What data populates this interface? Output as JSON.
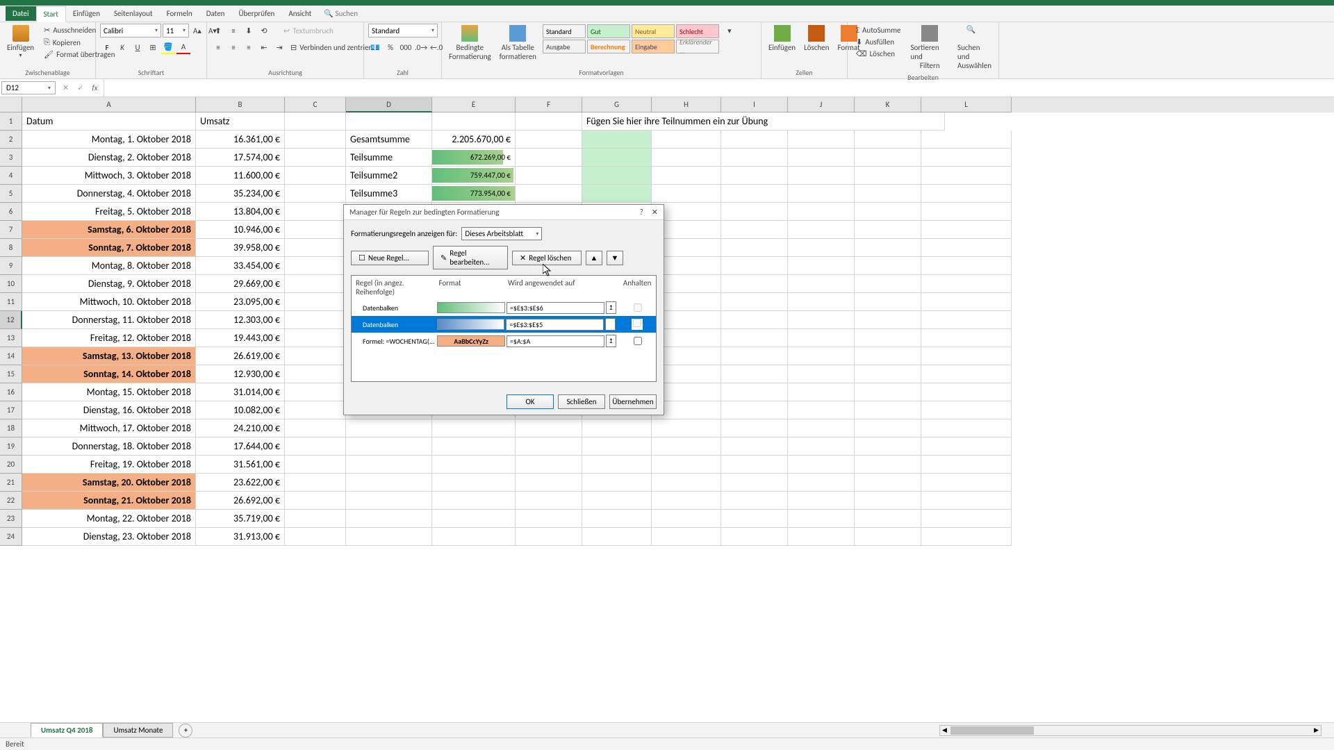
{
  "menu": {
    "datei": "Datei",
    "start": "Start",
    "einfugen": "Einfügen",
    "seitenlayout": "Seitenlayout",
    "formeln": "Formeln",
    "daten": "Daten",
    "uberprufen": "Überprüfen",
    "ansicht": "Ansicht",
    "suchen": "Suchen"
  },
  "ribbon": {
    "clipboard": {
      "paste": "Einfügen",
      "cut": "Ausschneiden",
      "copy": "Kopieren",
      "fmt": "Format übertragen",
      "label": "Zwischenablage"
    },
    "font": {
      "name": "Calibri",
      "size": "11",
      "label": "Schriftart"
    },
    "align": {
      "wrap": "Textumbruch",
      "merge": "Verbinden und zentrieren",
      "label": "Ausrichtung"
    },
    "number": {
      "format": "Standard",
      "label": "Zahl"
    },
    "styles": {
      "cond": "Bedingte",
      "cond2": "Formatierung",
      "table": "Als Tabelle",
      "table2": "formatieren",
      "std": "Standard",
      "gut": "Gut",
      "neutral": "Neutral",
      "schlecht": "Schlecht",
      "ausgabe": "Ausgabe",
      "berechnung": "Berechnung",
      "eingabe": "Eingabe",
      "erkl": "Erklärender ...",
      "label": "Formatvorlagen"
    },
    "cells": {
      "insert": "Einfügen",
      "delete": "Löschen",
      "format": "Format",
      "label": "Zellen"
    },
    "edit": {
      "sum": "AutoSumme",
      "fill": "Ausfüllen",
      "clear": "Löschen",
      "sort": "Sortieren und",
      "sort2": "Filtern",
      "find": "Suchen und",
      "find2": "Auswählen",
      "label": "Bearbeiten"
    }
  },
  "namebox": "D12",
  "columns": [
    "A",
    "B",
    "C",
    "D",
    "E",
    "F",
    "G",
    "H",
    "I",
    "J",
    "K",
    "L"
  ],
  "headers": {
    "datum": "Datum",
    "umsatz": "Umsatz",
    "note": "Fügen Sie hier ihre Teilnummen ein zur Übung"
  },
  "rows": [
    {
      "n": 2,
      "a": "Montag, 1. Oktober 2018",
      "b": "16.361,00 €",
      "d": "Gesamtsumme",
      "e": "2.205.670,00 €"
    },
    {
      "n": 3,
      "a": "Dienstag, 2. Oktober 2018",
      "b": "17.574,00 €",
      "d": "Teilsumme",
      "e": "672.269,00 €"
    },
    {
      "n": 4,
      "a": "Mittwoch, 3. Oktober 2018",
      "b": "11.600,00 €",
      "d": "Teilsumme2",
      "e": "759.447,00 €"
    },
    {
      "n": 5,
      "a": "Donnerstag, 4. Oktober 2018",
      "b": "35.234,00 €",
      "d": "Teilsumme3",
      "e": "773.954,00 €"
    },
    {
      "n": 6,
      "a": "Freitag, 5. Oktober 2018",
      "b": "13.804,00 €"
    },
    {
      "n": 7,
      "a": "Samstag, 6. Oktober 2018",
      "b": "10.946,00 €",
      "wk": true
    },
    {
      "n": 8,
      "a": "Sonntag, 7. Oktober 2018",
      "b": "39.958,00 €",
      "wk": true
    },
    {
      "n": 9,
      "a": "Montag, 8. Oktober 2018",
      "b": "33.454,00 €"
    },
    {
      "n": 10,
      "a": "Dienstag, 9. Oktober 2018",
      "b": "29.669,00 €"
    },
    {
      "n": 11,
      "a": "Mittwoch, 10. Oktober 2018",
      "b": "23.095,00 €"
    },
    {
      "n": 12,
      "a": "Donnerstag, 11. Oktober 2018",
      "b": "12.303,00 €",
      "sel": true
    },
    {
      "n": 13,
      "a": "Freitag, 12. Oktober 2018",
      "b": "19.443,00 €"
    },
    {
      "n": 14,
      "a": "Samstag, 13. Oktober 2018",
      "b": "26.619,00 €",
      "wk": true
    },
    {
      "n": 15,
      "a": "Sonntag, 14. Oktober 2018",
      "b": "12.930,00 €",
      "wk": true
    },
    {
      "n": 16,
      "a": "Montag, 15. Oktober 2018",
      "b": "31.014,00 €"
    },
    {
      "n": 17,
      "a": "Dienstag, 16. Oktober 2018",
      "b": "10.082,00 €"
    },
    {
      "n": 18,
      "a": "Mittwoch, 17. Oktober 2018",
      "b": "24.210,00 €"
    },
    {
      "n": 19,
      "a": "Donnerstag, 18. Oktober 2018",
      "b": "17.644,00 €"
    },
    {
      "n": 20,
      "a": "Freitag, 19. Oktober 2018",
      "b": "31.561,00 €"
    },
    {
      "n": 21,
      "a": "Samstag, 20. Oktober 2018",
      "b": "23.622,00 €",
      "wk": true
    },
    {
      "n": 22,
      "a": "Sonntag, 21. Oktober 2018",
      "b": "26.692,00 €",
      "wk": true
    },
    {
      "n": 23,
      "a": "Montag, 22. Oktober 2018",
      "b": "35.719,00 €"
    },
    {
      "n": 24,
      "a": "Dienstag, 23. Oktober 2018",
      "b": "31.913,00 €"
    }
  ],
  "sheets": {
    "active": "Umsatz Q4 2018",
    "other": "Umsatz Monate"
  },
  "status": "Bereit",
  "dialog": {
    "title": "Manager für Regeln zur bedingten Formatierung",
    "showfor": "Formatierungsregeln anzeigen für:",
    "scope": "Dieses Arbeitsblatt",
    "new": "Neue Regel...",
    "edit": "Regel bearbeiten...",
    "delete": "Regel löschen",
    "h_rule": "Regel (in angez. Reihenfolge)",
    "h_format": "Format",
    "h_apply": "Wird angewendet auf",
    "h_stop": "Anhalten",
    "rules": [
      {
        "name": "Datenbalken",
        "apply": "=$E$3:$E$6",
        "type": "g"
      },
      {
        "name": "Datenbalken",
        "apply": "=$E$3:$E$5",
        "type": "b",
        "sel": true
      },
      {
        "name": "Formel: =WOCHENTAG(...",
        "apply": "=$A:$A",
        "type": "t",
        "sample": "AaBbCcYyZz"
      }
    ],
    "ok": "OK",
    "close": "Schließen",
    "apply": "Übernehmen"
  }
}
